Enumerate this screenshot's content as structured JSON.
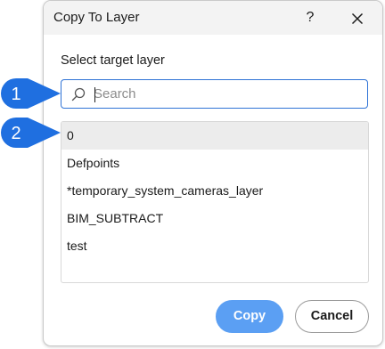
{
  "dialog": {
    "title": "Copy To Layer",
    "help_label": "?",
    "select_label": "Select target layer",
    "search": {
      "value": "",
      "placeholder": "Search"
    },
    "layers": [
      "0",
      "Defpoints",
      "*temporary_system_cameras_layer",
      "BIM_SUBTRACT",
      "test"
    ],
    "selected_layer": "0",
    "copy_label": "Copy",
    "cancel_label": "Cancel"
  },
  "callouts": [
    "1",
    "2"
  ],
  "colors": {
    "accent": "#2f73d6",
    "primary_button": "#5b9ff3",
    "callout_fill": "#1f6fe0",
    "selected_row": "#ececec",
    "titlebar": "#f3f3f3"
  }
}
